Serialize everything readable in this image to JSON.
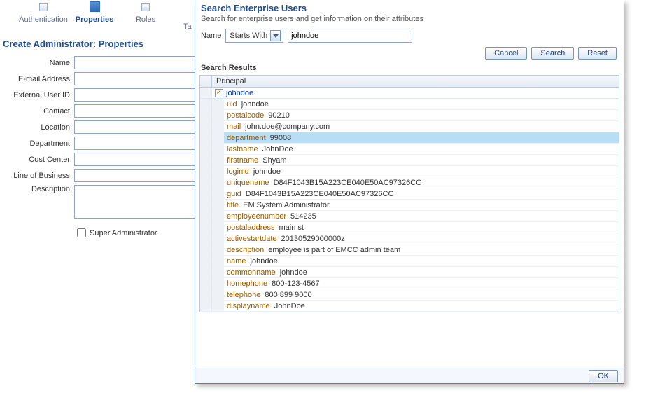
{
  "wizard": {
    "steps": [
      {
        "label": "Authentication"
      },
      {
        "label": "Properties"
      },
      {
        "label": "Roles"
      },
      {
        "label": "Ta"
      }
    ],
    "title": "Create Administrator: Properties",
    "fields": {
      "name": "Name",
      "email": "E-mail Address",
      "external_id": "External User ID",
      "contact": "Contact",
      "location": "Location",
      "department": "Department",
      "cost_center": "Cost Center",
      "lob": "Line of Business",
      "description": "Description"
    },
    "super_admin_label": "Super Administrator"
  },
  "dialog": {
    "title": "Search Enterprise Users",
    "subtitle": "Search for enterprise users and get information on their attributes",
    "name_label": "Name",
    "operator": "Starts With",
    "search_value": "johndoe",
    "buttons": {
      "cancel": "Cancel",
      "search": "Search",
      "reset": "Reset",
      "ok": "OK"
    },
    "results_header": "Search Results",
    "column_header": "Principal",
    "principal": "johndoe",
    "attributes": [
      {
        "key": "uid",
        "value": "johndoe",
        "highlight": false
      },
      {
        "key": "postalcode",
        "value": "90210",
        "highlight": false
      },
      {
        "key": "mail",
        "value": "john.doe@company.com",
        "highlight": false
      },
      {
        "key": "department",
        "value": "99008",
        "highlight": true
      },
      {
        "key": "lastname",
        "value": "JohnDoe",
        "highlight": false
      },
      {
        "key": "firstname",
        "value": "Shyam",
        "highlight": false
      },
      {
        "key": "loginid",
        "value": "johndoe",
        "highlight": false
      },
      {
        "key": "uniquename",
        "value": "D84F1043B15A223CE040E50AC97326CC",
        "highlight": false
      },
      {
        "key": "guid",
        "value": "D84F1043B15A223CE040E50AC97326CC",
        "highlight": false
      },
      {
        "key": "title",
        "value": "EM System Administrator",
        "highlight": false
      },
      {
        "key": "employeenumber",
        "value": "514235",
        "highlight": false
      },
      {
        "key": "postaladdress",
        "value": "main st",
        "highlight": false
      },
      {
        "key": "activestartdate",
        "value": "20130529000000z",
        "highlight": false
      },
      {
        "key": "description",
        "value": "employee is part of EMCC admin team",
        "highlight": false
      },
      {
        "key": "name",
        "value": "johndoe",
        "highlight": false
      },
      {
        "key": "commonname",
        "value": "johndoe",
        "highlight": false
      },
      {
        "key": "homephone",
        "value": "800-123-4567",
        "highlight": false
      },
      {
        "key": "telephone",
        "value": "800 899 9000",
        "highlight": false
      },
      {
        "key": "displayname",
        "value": "JohnDoe",
        "highlight": false
      }
    ]
  }
}
